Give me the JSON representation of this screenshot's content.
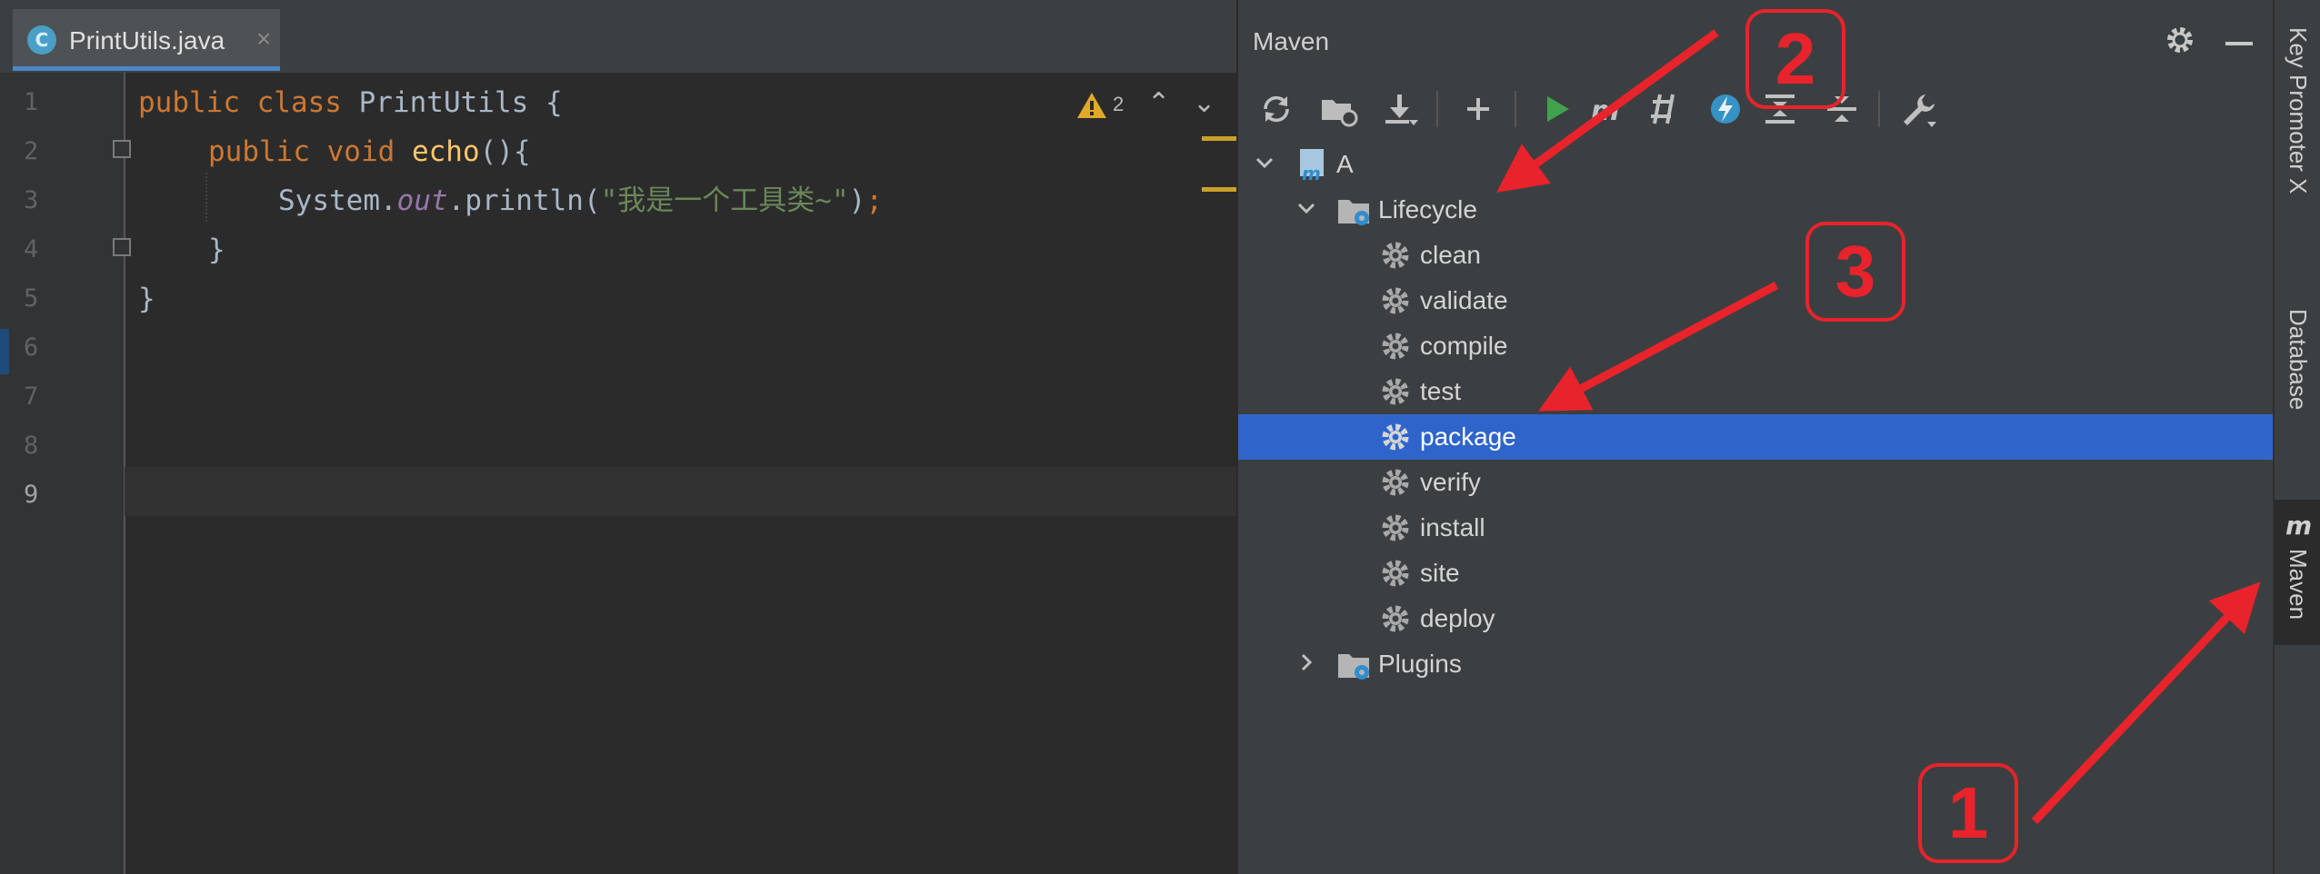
{
  "editor": {
    "tab": {
      "icon": "C",
      "filename": "PrintUtils.java",
      "close": "×"
    },
    "line_numbers": [
      "1",
      "2",
      "3",
      "4",
      "5",
      "6",
      "7",
      "8",
      "9"
    ],
    "code": {
      "l1": {
        "kw": "public class ",
        "cls": "PrintUtils ",
        "rest": "{"
      },
      "l2": {
        "kw": "public void ",
        "fn": "echo",
        "rest": "(){"
      },
      "l3": {
        "a": "System.",
        "fld": "out",
        "b": ".println(",
        "str": "\"我是一个工具类~\"",
        "c": ")",
        "semi": ";"
      },
      "l4": {
        "rest": "}"
      },
      "l5": {
        "rest": "}"
      }
    },
    "inspections": {
      "warning_count": "2",
      "up": "⌃",
      "down": "⌄"
    }
  },
  "maven": {
    "title": "Maven",
    "tree": {
      "root": "A",
      "lifecycle": "Lifecycle",
      "goals": [
        "clean",
        "validate",
        "compile",
        "test",
        "package",
        "verify",
        "install",
        "site",
        "deploy"
      ],
      "selected_goal": "package",
      "plugins": "Plugins"
    }
  },
  "right_strip": {
    "tabs": [
      "Key Promoter X",
      "Database",
      "Maven"
    ]
  },
  "annotations": {
    "badge1": "1",
    "badge2": "2",
    "badge3": "3",
    "color": "#e8232b"
  },
  "colors": {
    "selection": "#2f65ca",
    "accent": "#4a88c7",
    "panel": "#3c3f41",
    "editor_bg": "#2b2b2b"
  }
}
